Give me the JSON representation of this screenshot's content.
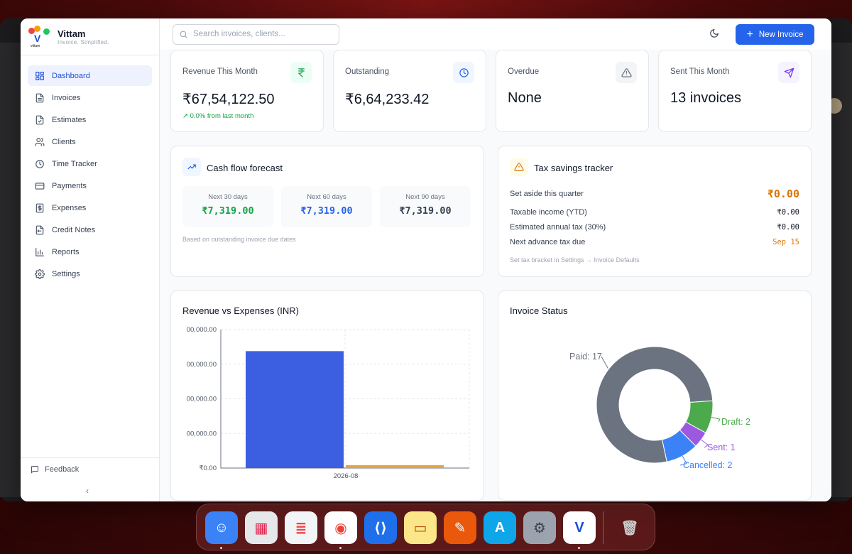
{
  "app": {
    "name": "Vittam",
    "tagline": "Invoice. Simplified.",
    "logo_letter": "V",
    "logo_sub": "vittam"
  },
  "sidebar": {
    "items": [
      {
        "label": "Dashboard",
        "icon": "dashboard-icon",
        "active": true
      },
      {
        "label": "Invoices",
        "icon": "file-icon"
      },
      {
        "label": "Estimates",
        "icon": "file-check-icon"
      },
      {
        "label": "Clients",
        "icon": "users-icon"
      },
      {
        "label": "Time Tracker",
        "icon": "clock-icon"
      },
      {
        "label": "Payments",
        "icon": "credit-card-icon"
      },
      {
        "label": "Expenses",
        "icon": "receipt-icon"
      },
      {
        "label": "Credit Notes",
        "icon": "credit-note-icon"
      },
      {
        "label": "Reports",
        "icon": "bar-chart-icon"
      },
      {
        "label": "Settings",
        "icon": "gear-icon"
      }
    ],
    "feedback": "Feedback",
    "collapse": "‹"
  },
  "topbar": {
    "search_placeholder": "Search invoices, clients...",
    "new_invoice": "New Invoice",
    "plus": "+"
  },
  "stats": [
    {
      "label": "Revenue This Month",
      "value": "₹67,54,122.50",
      "delta": "↗ 0.0% from last month",
      "icon": "rupee-icon",
      "color": "#16a34a",
      "bg": "#ecfdf5"
    },
    {
      "label": "Outstanding",
      "value": "₹6,64,233.42",
      "icon": "clock-icon",
      "color": "#2563eb",
      "bg": "#eff6ff"
    },
    {
      "label": "Overdue",
      "value": "None",
      "icon": "warning-icon",
      "color": "#6b7280",
      "bg": "#f3f4f6"
    },
    {
      "label": "Sent This Month",
      "value": "13 invoices",
      "icon": "send-icon",
      "color": "#7c3aed",
      "bg": "#f5f3ff"
    }
  ],
  "cashflow": {
    "title": "Cash flow forecast",
    "boxes": [
      {
        "label": "Next 30 days",
        "value": "₹7,319.00",
        "color": "#16a34a"
      },
      {
        "label": "Next 60 days",
        "value": "₹7,319.00",
        "color": "#2563eb"
      },
      {
        "label": "Next 90 days",
        "value": "₹7,319.00",
        "color": "#374151"
      }
    ],
    "note": "Based on outstanding invoice due dates"
  },
  "tax": {
    "title": "Tax savings tracker",
    "rows": [
      {
        "label": "Set aside this quarter",
        "value": "₹0.00"
      },
      {
        "label": "Taxable income (YTD)",
        "value": "₹0.00"
      },
      {
        "label": "Estimated annual tax (30%)",
        "value": "₹0.00"
      },
      {
        "label": "Next advance tax due",
        "value": "Sep 15"
      }
    ],
    "note": "Set tax bracket in Settings → Invoice Defaults"
  },
  "revenue_chart": {
    "title": "Revenue vs Expenses (INR)"
  },
  "status_chart": {
    "title": "Invoice Status"
  },
  "chart_data": [
    {
      "type": "bar",
      "title": "Revenue vs Expenses (INR)",
      "categories": [
        "2026-08"
      ],
      "series": [
        {
          "values": [
            6754122.5
          ],
          "color": "#3b5fe0"
        },
        {
          "values": [
            80000
          ],
          "color": "#e8a33d"
        }
      ],
      "ytick_labels": [
        "₹0.00",
        "00,000.00",
        "00,000.00",
        "00,000.00",
        "00,000.00"
      ],
      "ylim": [
        0,
        8000000
      ],
      "grid": true
    },
    {
      "type": "pie",
      "title": "Invoice Status",
      "donut": true,
      "slices": [
        {
          "label": "Paid",
          "value": 17,
          "color": "#6b7280"
        },
        {
          "label": "Draft",
          "value": 2,
          "color": "#4caa4c"
        },
        {
          "label": "Sent",
          "value": 1,
          "color": "#9b59e0"
        },
        {
          "label": "Cancelled",
          "value": 2,
          "color": "#3b82f6"
        }
      ]
    }
  ],
  "dock": {
    "apps": [
      "finder-icon",
      "launchpad-icon",
      "reminders-icon",
      "chrome-icon",
      "vscode-icon",
      "notes-icon",
      "pages-icon",
      "app-store-icon",
      "system-settings-icon",
      "vittam-icon",
      "trash-icon"
    ]
  }
}
